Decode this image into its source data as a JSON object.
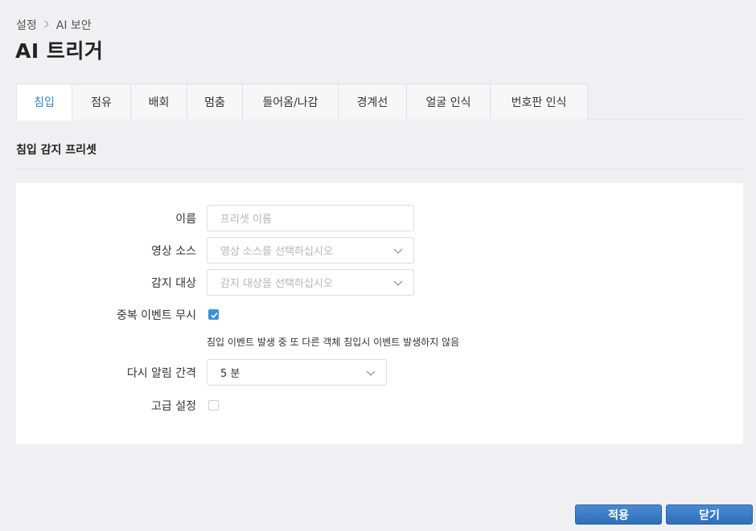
{
  "breadcrumb": {
    "parent": "설정",
    "current": "AI 보안"
  },
  "page_title": "AI 트리거",
  "tabs": [
    {
      "label": "침입",
      "active": true
    },
    {
      "label": "점유",
      "active": false
    },
    {
      "label": "배회",
      "active": false
    },
    {
      "label": "멈춤",
      "active": false
    },
    {
      "label": "들어옴/나감",
      "active": false
    },
    {
      "label": "경계선",
      "active": false
    },
    {
      "label": "얼굴 인식",
      "active": false
    },
    {
      "label": "번호판 인식",
      "active": false
    }
  ],
  "section_title": "침입 감지 프리셋",
  "form": {
    "name": {
      "label": "이름",
      "placeholder": "프리셋 이름",
      "value": ""
    },
    "video_source": {
      "label": "영상 소스",
      "placeholder": "영상 소스를 선택하십시오"
    },
    "detection_target": {
      "label": "감지 대상",
      "placeholder": "감지 대상을 선택하십시오"
    },
    "ignore_duplicate": {
      "label": "중복 이벤트 무시",
      "checked": true,
      "hint": "침입 이벤트 발생 중 또 다른 객체 침입시 이벤트 발생하지 않음"
    },
    "realert_interval": {
      "label": "다시 알림 간격",
      "value": "5 분"
    },
    "advanced": {
      "label": "고급 설정",
      "checked": false
    }
  },
  "buttons": {
    "apply": "적용",
    "close": "닫기"
  },
  "colors": {
    "accent": "#2f87d8",
    "button": "#3a7cc8",
    "background": "#f0f0f2"
  }
}
